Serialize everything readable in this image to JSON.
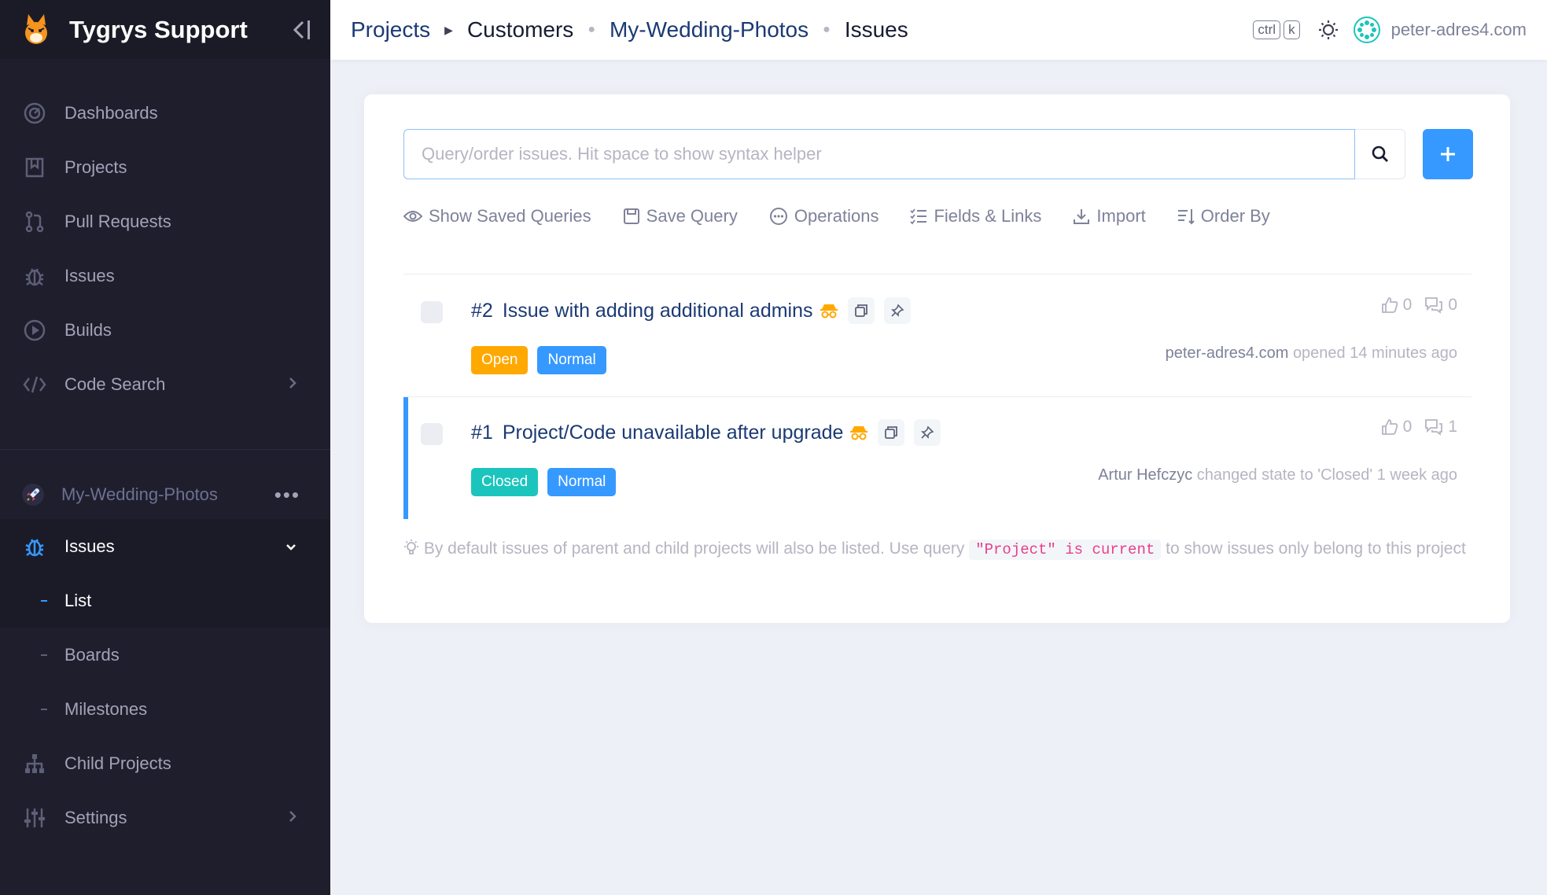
{
  "app": {
    "title": "Tygrys Support"
  },
  "sidebar": {
    "nav": [
      {
        "label": "Dashboards",
        "icon": "dashboard-icon"
      },
      {
        "label": "Projects",
        "icon": "projects-icon"
      },
      {
        "label": "Pull Requests",
        "icon": "pull-request-icon"
      },
      {
        "label": "Issues",
        "icon": "bug-icon"
      },
      {
        "label": "Builds",
        "icon": "play-icon"
      },
      {
        "label": "Code Search",
        "icon": "code-icon"
      }
    ],
    "project": {
      "name": "My-Wedding-Photos"
    },
    "project_nav": {
      "issues": "Issues",
      "sub": [
        "List",
        "Boards",
        "Milestones"
      ],
      "child_projects": "Child Projects",
      "settings": "Settings"
    }
  },
  "header": {
    "breadcrumbs": [
      "Projects",
      "Customers",
      "My-Wedding-Photos",
      "Issues"
    ],
    "kbd": [
      "ctrl",
      "k"
    ],
    "user": "peter-adres4.com"
  },
  "search": {
    "placeholder": "Query/order issues. Hit space to show syntax helper"
  },
  "toolbar": {
    "saved": "Show Saved Queries",
    "save": "Save Query",
    "operations": "Operations",
    "fields": "Fields & Links",
    "import": "Import",
    "order": "Order By"
  },
  "issues": [
    {
      "number": "#2",
      "title": "Issue with adding additional admins",
      "state": "Open",
      "priority": "Normal",
      "votes": "0",
      "comments": "0",
      "who": "peter-adres4.com",
      "activity": "opened 14 minutes ago"
    },
    {
      "number": "#1",
      "title": "Project/Code unavailable after upgrade",
      "state": "Closed",
      "priority": "Normal",
      "votes": "0",
      "comments": "1",
      "who": "Artur Hefczyc",
      "activity": "changed state to 'Closed' 1 week ago"
    }
  ],
  "hint": {
    "before": "By default issues of parent and child projects will also be listed. Use query",
    "code": "\"Project\" is current",
    "after": "to show issues only belong to this project"
  },
  "colors": {
    "sidebar_bg": "#1e1e2d",
    "primary": "#3699ff",
    "open": "#ffa800",
    "closed": "#1bc5bd"
  }
}
